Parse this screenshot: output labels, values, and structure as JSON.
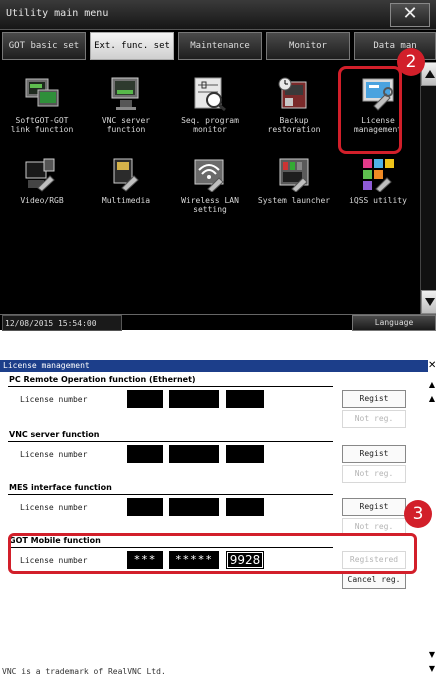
{
  "utility_menu": {
    "title": "Utility main menu",
    "close_symbol": "✕",
    "tabs": [
      {
        "label": "GOT basic set",
        "active": false
      },
      {
        "label": "Ext. func. set",
        "active": true
      },
      {
        "label": "Maintenance",
        "active": false
      },
      {
        "label": "Monitor",
        "active": false
      },
      {
        "label": "Data man",
        "active": false
      }
    ],
    "apps": [
      {
        "label_1": "SoftGOT-GOT",
        "label_2": "link function",
        "icon": "softgot-link-icon"
      },
      {
        "label_1": "VNC server",
        "label_2": "function",
        "icon": "vnc-server-icon"
      },
      {
        "label_1": "Seq. program",
        "label_2": "monitor",
        "icon": "sequence-program-icon"
      },
      {
        "label_1": "Backup",
        "label_2": "restoration",
        "icon": "backup-restoration-icon"
      },
      {
        "label_1": "License",
        "label_2": "management",
        "icon": "license-management-icon"
      },
      {
        "label_1": "Video/RGB",
        "label_2": "",
        "icon": "video-rgb-icon"
      },
      {
        "label_1": "Multimedia",
        "label_2": "",
        "icon": "multimedia-icon"
      },
      {
        "label_1": "Wireless LAN",
        "label_2": "setting",
        "icon": "wireless-lan-icon"
      },
      {
        "label_1": "System launcher",
        "label_2": "",
        "icon": "system-launcher-icon"
      },
      {
        "label_1": "iQSS utility",
        "label_2": "",
        "icon": "iqss-utility-icon"
      }
    ],
    "datetime": "12/08/2015 15:54:00",
    "language_button": "Language",
    "callout": "2"
  },
  "license_management": {
    "title": "License management",
    "close_symbol": "✕",
    "sections": [
      {
        "title": "PC Remote Operation function (Ethernet)",
        "field_label": "License number",
        "keys": [
          "",
          "",
          ""
        ],
        "primary_button": "Regist",
        "secondary_button": "Not reg."
      },
      {
        "title": "VNC server function",
        "field_label": "License number",
        "keys": [
          "",
          "",
          ""
        ],
        "primary_button": "Regist",
        "secondary_button": "Not reg."
      },
      {
        "title": "MES interface function",
        "field_label": "License number",
        "keys": [
          "",
          "",
          ""
        ],
        "primary_button": "Regist",
        "secondary_button": "Not reg."
      },
      {
        "title": "GOT Mobile function",
        "field_label": "License number",
        "keys": [
          "***",
          "*****",
          "9928"
        ],
        "primary_button": "Registered",
        "secondary_button": "Cancel reg."
      }
    ],
    "footer_note": "VNC is a trademark of RealVNC Ltd.",
    "callout": "3",
    "scroll_up_symbol": "▲",
    "scroll_down_symbol": "▼"
  },
  "colors": {
    "highlight_red": "#d21f2a",
    "title_blue": "#1c3e8a"
  }
}
